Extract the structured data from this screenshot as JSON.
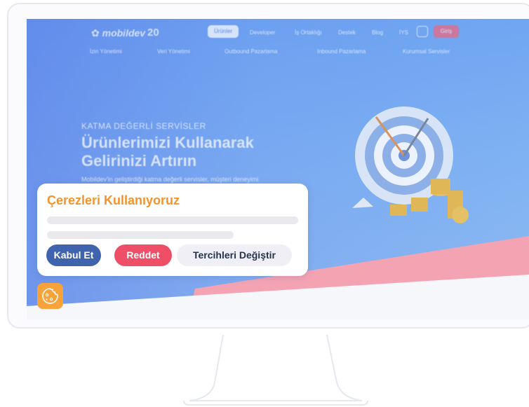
{
  "nav": {
    "logo": "mobildev",
    "logo_badge": "20",
    "active": "Ürünler",
    "items": [
      "Developer",
      "İş Ortaklığı",
      "Destek",
      "Blog",
      "İYS"
    ],
    "login": "Giriş"
  },
  "subnav": [
    "İzin Yönetimi",
    "Veri Yönetimi",
    "Outbound Pazarlama",
    "Inbound Pazarlama",
    "Kurumsal Servisler"
  ],
  "hero": {
    "kicker": "KATMA DEĞERLİ SERVİSLER",
    "title_line1": "Ürünlerimizi Kullanarak",
    "title_line2": "Gelirinizi Artırın",
    "desc": "Mobildev'in geliştirdiği katma değerli servisler, müşteri deneyimi"
  },
  "cookie": {
    "title": "Çerezleri Kullanıyoruz",
    "accept": "Kabul Et",
    "reject": "Reddet",
    "preferences": "Tercihleri Değiştir"
  },
  "colors": {
    "title_orange": "#f2932b",
    "accept_blue": "#3f63ad",
    "reject_red": "#ef4e67",
    "fab_orange": "#f7a33a"
  },
  "icons": {
    "fab": "cookie-icon",
    "nav_search": "search-icon"
  }
}
